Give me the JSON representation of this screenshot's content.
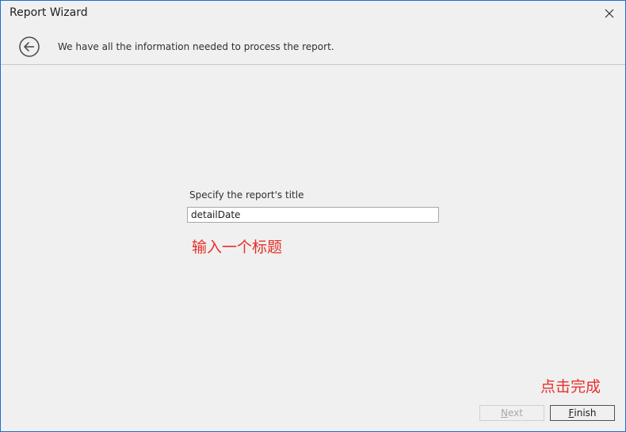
{
  "window": {
    "title": "Report Wizard"
  },
  "header": {
    "message": "We have all the information needed to process the report."
  },
  "form": {
    "label": "Specify the report's title",
    "title_value": "detailDate"
  },
  "annotations": {
    "enter_title": "输入一个标题",
    "click_finish": "点击完成"
  },
  "buttons": {
    "next_mnemonic": "N",
    "next_rest": "ext",
    "next_enabled": false,
    "finish_mnemonic": "F",
    "finish_rest": "inish"
  },
  "icons": {
    "close": "close-icon",
    "back": "back-arrow-icon"
  },
  "colors": {
    "annotation": "#e8302a",
    "window_border": "#1e6fcf"
  }
}
